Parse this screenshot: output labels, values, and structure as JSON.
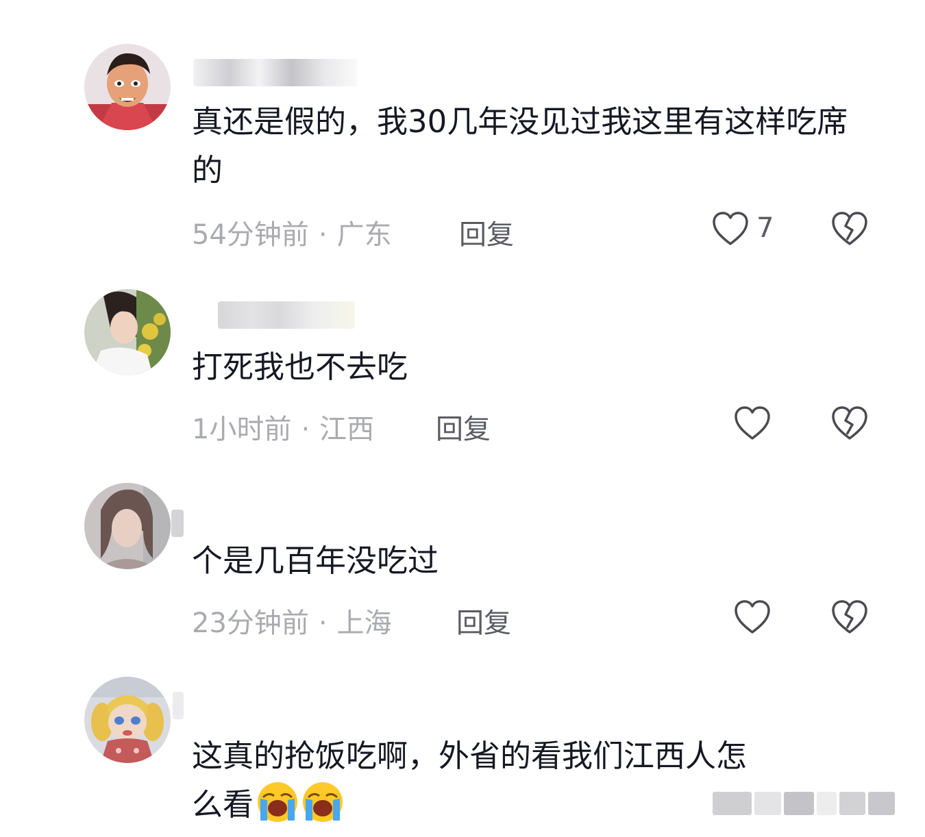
{
  "comments": [
    {
      "avatar": "cartoon-character-avatar",
      "text": "真还是假的，我30几年没见过我这里有这样吃席的",
      "time": "54分钟前",
      "location": "广东",
      "reply_label": "回复",
      "likes": "7"
    },
    {
      "avatar": "woman-with-flowers-avatar",
      "text": "打死我也不去吃",
      "time": "1小时前",
      "location": "江西",
      "reply_label": "回复",
      "likes": ""
    },
    {
      "avatar": "woman-portrait-avatar",
      "text": "个是几百年没吃过",
      "time": "23分钟前",
      "location": "上海",
      "reply_label": "回复",
      "likes": ""
    },
    {
      "avatar": "doll-avatar",
      "text_line1": "这真的抢饭吃啊，外省的看我们江西人怎",
      "text_line2": "么看",
      "emoji": [
        "loudly-crying-face-emoji",
        "loudly-crying-face-emoji"
      ]
    }
  ],
  "separator": "·",
  "colors": {
    "text": "#161823",
    "meta": "#aaabb0",
    "action": "#5a5b63"
  },
  "icons": [
    "heart-icon",
    "broken-heart-icon"
  ]
}
